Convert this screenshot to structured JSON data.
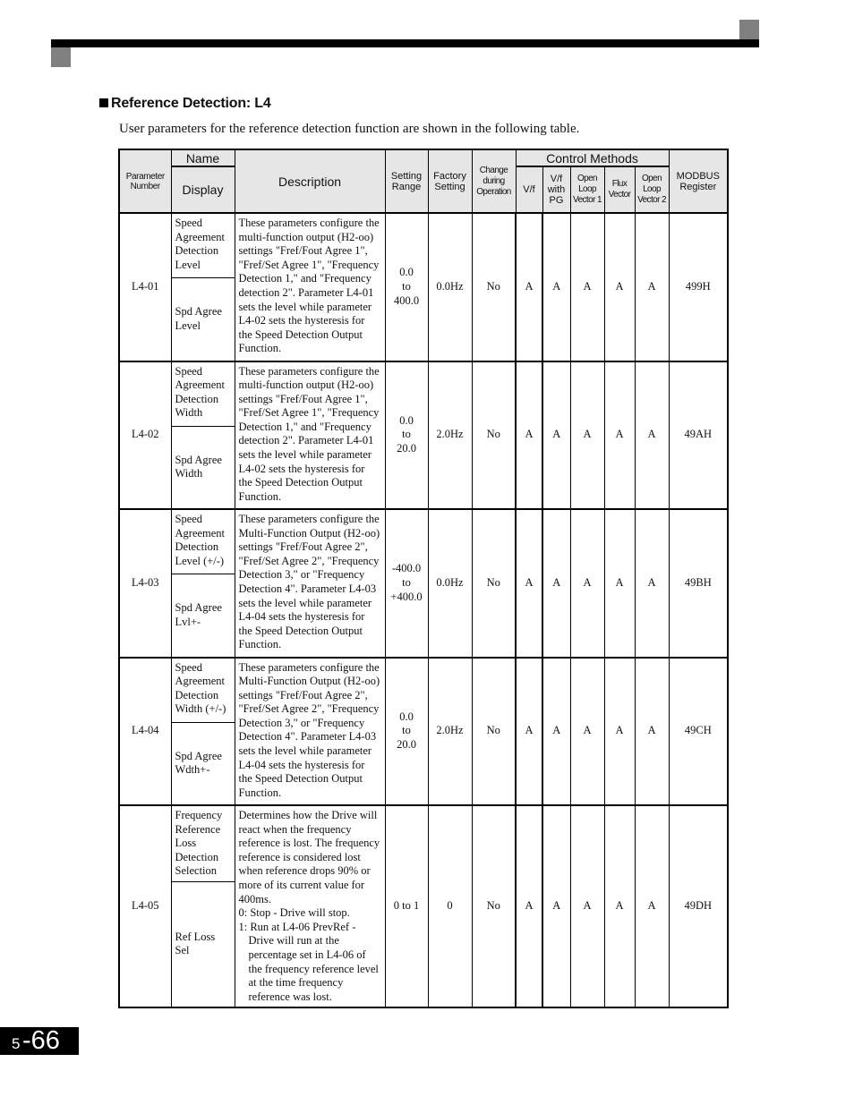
{
  "section": {
    "title": "Reference Detection: L4",
    "intro": "User parameters for the reference detection function are shown in the following table."
  },
  "table": {
    "headers": {
      "parameter_number": "Parameter Number",
      "name": "Name",
      "display": "Display",
      "description": "Description",
      "setting_range": "Setting Range",
      "factory_setting": "Factory Setting",
      "change_during_operation": "Change during Operation",
      "control_methods": "Control Methods",
      "vf": "V/f",
      "vf_pg": "V/f with PG",
      "olv1": "Open Loop Vector 1",
      "flux_vector": "Flux Vector",
      "olv2": "Open Loop Vector 2",
      "modbus": "MODBUS Register"
    },
    "rows": [
      {
        "param": "L4-01",
        "name": "Speed Agreement Detection Level",
        "display": "Spd Agree Level",
        "description": "These parameters configure the multi-function output (H2-oo) settings \"Fref/Fout Agree 1\", \"Fref/Set Agree 1\", \"Frequency Detection 1,\" and \"Frequency detection 2\". Parameter L4-01 sets the level while parameter L4-02 sets the hysteresis for the Speed Detection Output Function.",
        "range_from": "0.0",
        "range_to": "to",
        "range_end": "400.0",
        "factory": "0.0Hz",
        "change": "No",
        "vf": "A",
        "vf_pg": "A",
        "olv1": "A",
        "flux": "A",
        "olv2": "A",
        "modbus": "499H"
      },
      {
        "param": "L4-02",
        "name": "Speed Agreement Detection Width",
        "display": "Spd Agree Width",
        "description": "These parameters configure the multi-function output (H2-oo) settings \"Fref/Fout Agree 1\", \"Fref/Set Agree 1\", \"Frequency Detection 1,\" and \"Frequency detection 2\". Parameter L4-01 sets the level while parameter L4-02 sets the hysteresis for the Speed Detection Output Function.",
        "range_from": "0.0",
        "range_to": "to",
        "range_end": "20.0",
        "factory": "2.0Hz",
        "change": "No",
        "vf": "A",
        "vf_pg": "A",
        "olv1": "A",
        "flux": "A",
        "olv2": "A",
        "modbus": "49AH"
      },
      {
        "param": "L4-03",
        "name": "Speed Agreement Detection Level (+/-)",
        "display": "Spd Agree Lvl+-",
        "description": "These parameters configure the Multi-Function Output (H2-oo) settings \"Fref/Fout Agree 2\", \"Fref/Set Agree 2\", \"Frequency Detection 3,\" or \"Frequency Detection 4\". Parameter L4-03 sets the level while parameter L4-04 sets the hysteresis for the Speed Detection Output Function.",
        "range_from": "-400.0",
        "range_to": "to",
        "range_end": "+400.0",
        "factory": "0.0Hz",
        "change": "No",
        "vf": "A",
        "vf_pg": "A",
        "olv1": "A",
        "flux": "A",
        "olv2": "A",
        "modbus": "49BH"
      },
      {
        "param": "L4-04",
        "name": "Speed Agreement Detection Width (+/-)",
        "display": "Spd Agree Wdth+-",
        "description": "These parameters configure the Multi-Function Output (H2-oo) settings \"Fref/Fout Agree 2\", \"Fref/Set Agree 2\", \"Frequency Detection 3,\" or \"Frequency Detection 4\". Parameter L4-03 sets the level while parameter L4-04 sets the hysteresis for the Speed Detection Output Function.",
        "range_from": "0.0",
        "range_to": "to",
        "range_end": "20.0",
        "factory": "2.0Hz",
        "change": "No",
        "vf": "A",
        "vf_pg": "A",
        "olv1": "A",
        "flux": "A",
        "olv2": "A",
        "modbus": "49CH"
      },
      {
        "param": "L4-05",
        "name": "Frequency Reference Loss Detection Selection",
        "display": "Ref Loss Sel",
        "description": "Determines how the Drive will react when the frequency reference is lost. The frequency reference is considered lost when reference drops 90% or more of its current value for 400ms.",
        "option_0": "0: Stop - Drive will stop.",
        "option_1": "1: Run at L4-06 PrevRef -",
        "option_1_detail": "Drive will run at the percentage set in L4-06 of the frequency reference level at the time frequency reference was lost.",
        "range": "0 to 1",
        "factory": "0",
        "change": "No",
        "vf": "A",
        "vf_pg": "A",
        "olv1": "A",
        "flux": "A",
        "olv2": "A",
        "modbus": "49DH"
      }
    ]
  },
  "footer": {
    "chapter": "5",
    "page": "-66"
  }
}
